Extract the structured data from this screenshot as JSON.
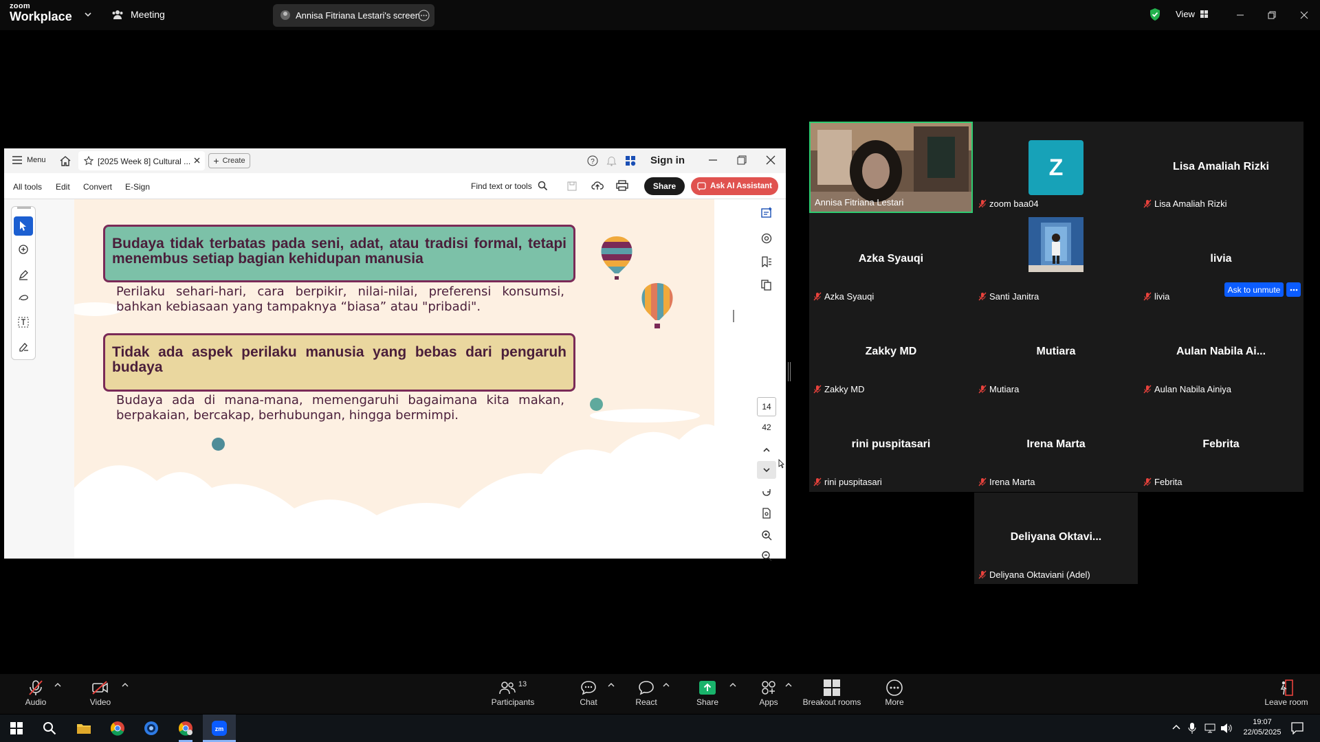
{
  "topbar": {
    "logo_line1": "zoom",
    "logo_line2": "Workplace",
    "meeting_label": "Meeting",
    "share_label": "Annisa Fitriana Lestari's screen",
    "view_label": "View"
  },
  "acrobat": {
    "menu_label": "Menu",
    "tab_title": "[2025 Week 8] Cultural ...",
    "create_label": "Create",
    "sign_in": "Sign in",
    "tools": [
      "All tools",
      "Edit",
      "Convert",
      "E-Sign"
    ],
    "find_placeholder": "Find text or tools",
    "share_btn": "Share",
    "ai_btn": "Ask AI Assistant",
    "page_current": "14",
    "page_total": "42"
  },
  "slide": {
    "heading1": "Budaya tidak terbatas pada seni, adat, atau tradisi formal, tetapi menembus setiap bagian kehidupan manusia",
    "body1": "Perilaku sehari-hari, cara berpikir, nilai-nilai, preferensi konsumsi, bahkan kebiasaan yang tampaknya “biasa” atau \"pribadi\".",
    "heading2": "Tidak ada aspek perilaku manusia yang bebas dari pengaruh budaya",
    "body2": "Budaya ada di mana-mana, memengaruhi bagaimana kita makan, berpakaian, bercakap, berhubungan, hingga bermimpi."
  },
  "gallery": [
    {
      "label": "Annisa Fitriana Lestari",
      "display": "",
      "kind": "video"
    },
    {
      "label": "zoom baa04",
      "display": "Z",
      "kind": "avatar-letter"
    },
    {
      "label": "Lisa Amaliah Rizki",
      "display": "Lisa Amaliah Rizki",
      "kind": "name"
    },
    {
      "label": "Azka Syauqi",
      "display": "Azka Syauqi",
      "kind": "name"
    },
    {
      "label": "Santi Janitra",
      "display": "",
      "kind": "photo"
    },
    {
      "label": "livia",
      "display": "livia",
      "kind": "name"
    },
    {
      "label": "Zakky MD",
      "display": "Zakky MD",
      "kind": "name"
    },
    {
      "label": "Mutiara",
      "display": "Mutiara",
      "kind": "name"
    },
    {
      "label": "Aulan Nabila Ainiya",
      "display": "Aulan Nabila Ai...",
      "kind": "name"
    },
    {
      "label": "rini puspitasari",
      "display": "rini puspitasari",
      "kind": "name"
    },
    {
      "label": "Irena Marta",
      "display": "Irena Marta",
      "kind": "name"
    },
    {
      "label": "Febrita",
      "display": "Febrita",
      "kind": "name"
    },
    {
      "label": "Deliyana Oktaviani (Adel)",
      "display": "Deliyana Oktavi...",
      "kind": "name"
    }
  ],
  "ask_unmute": "Ask to unmute",
  "toolbar": {
    "audio": "Audio",
    "video": "Video",
    "participants": "Participants",
    "participants_count": "13",
    "chat": "Chat",
    "react": "React",
    "share": "Share",
    "apps": "Apps",
    "breakout": "Breakout rooms",
    "more": "More",
    "leave": "Leave room"
  },
  "taskbar": {
    "time": "19:07",
    "date": "22/05/2025"
  },
  "colors": {
    "zoom_blue": "#0b5cff",
    "share_green": "#19b36b",
    "muted_red": "#e8423c",
    "acrobat_red": "#e0524f"
  }
}
